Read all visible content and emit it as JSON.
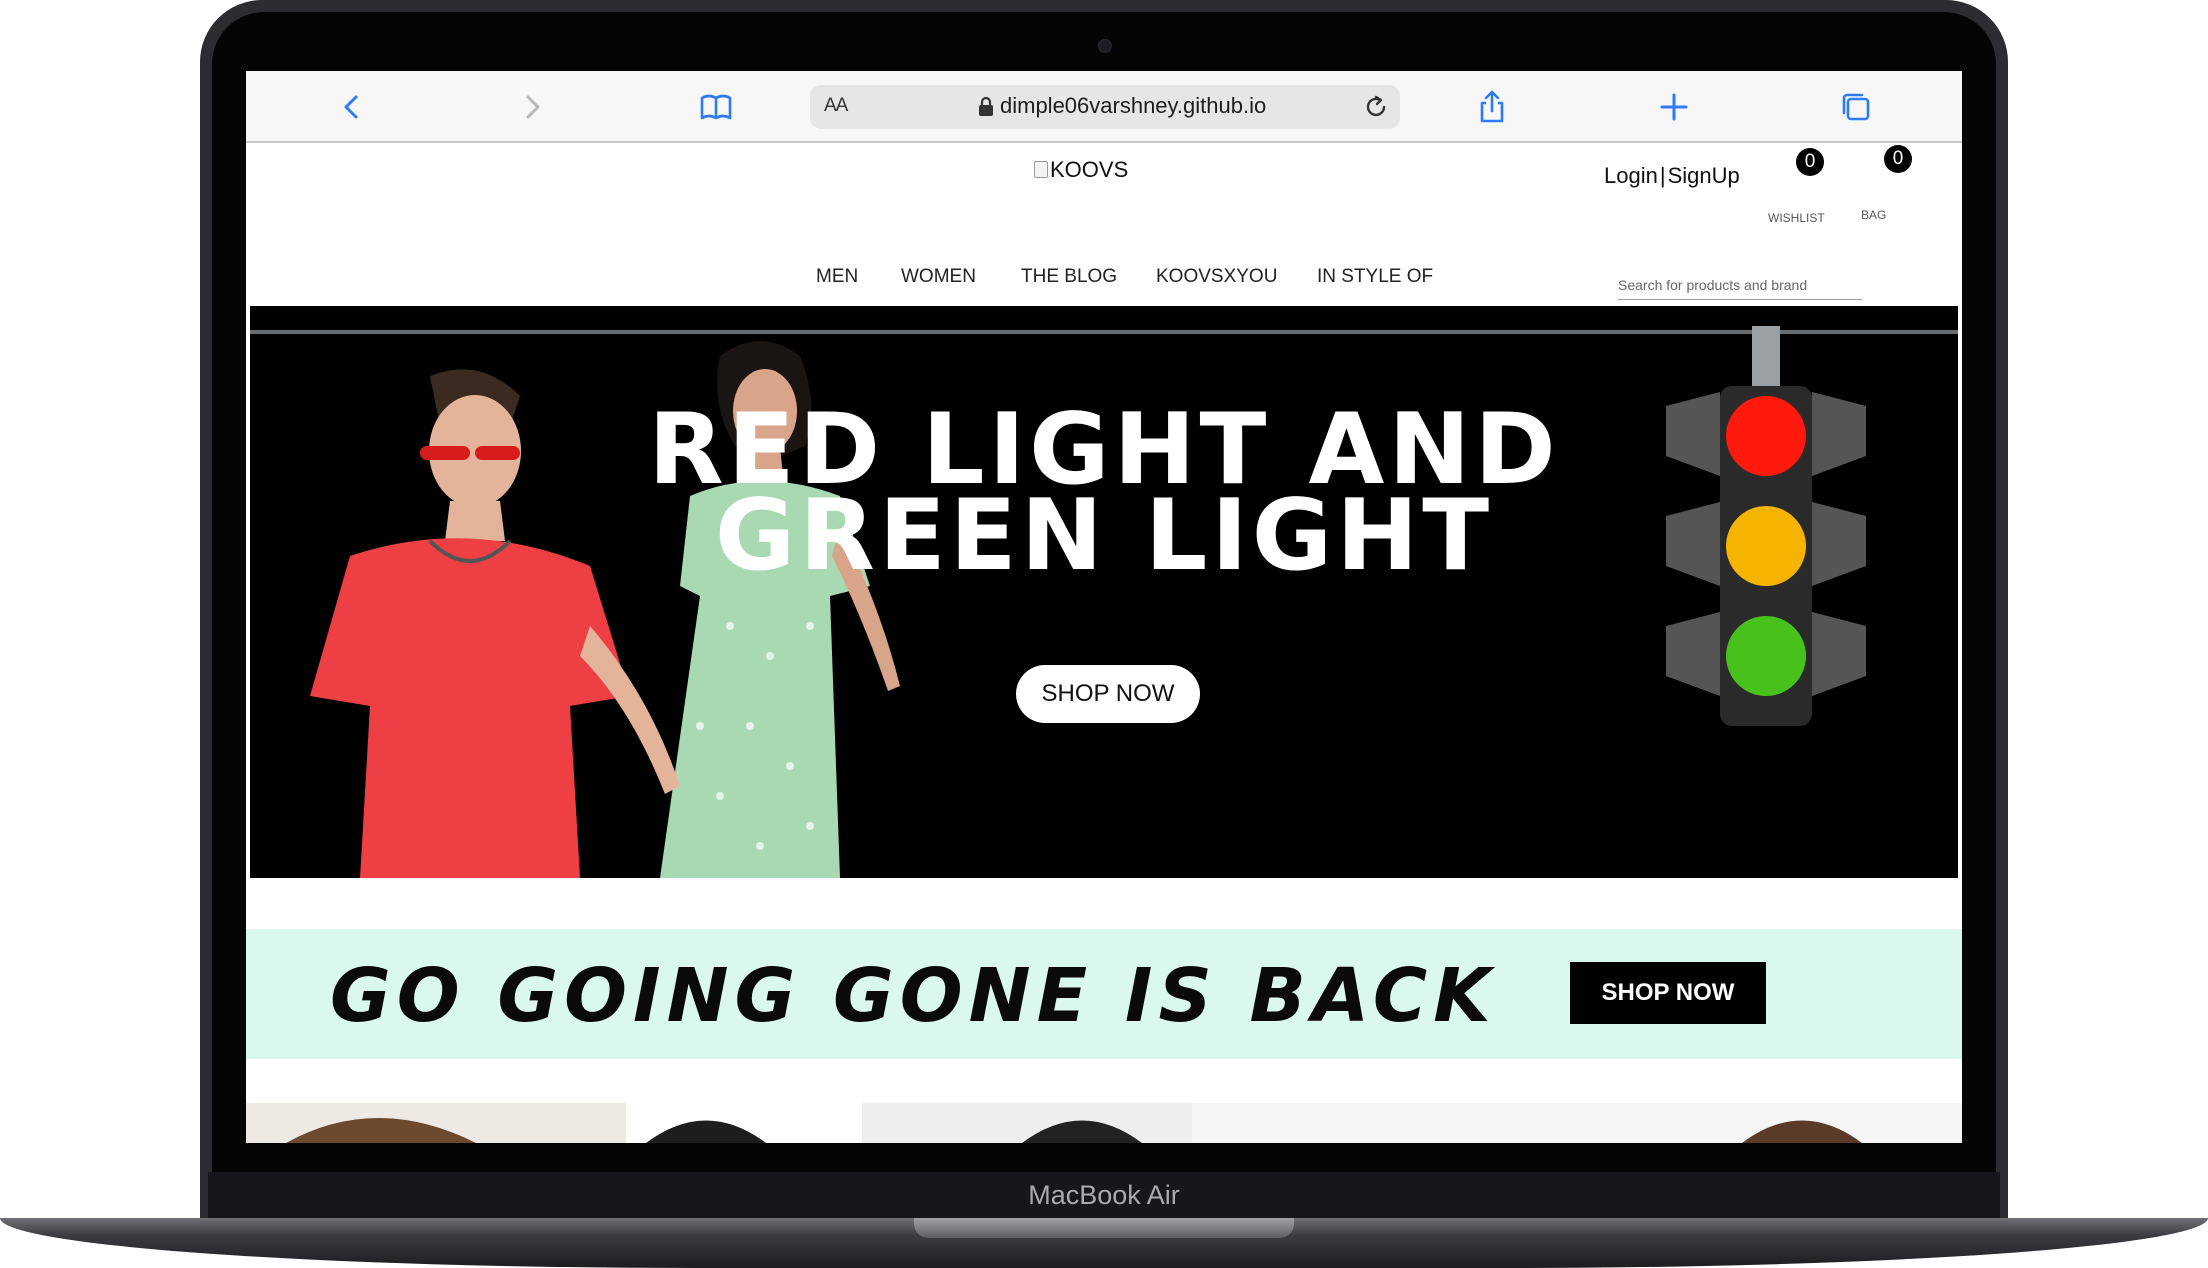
{
  "device": {
    "model_label": "MacBook Air"
  },
  "browser": {
    "text_size_label": "AA",
    "url": "dimple06varshney.github.io",
    "accent": "#2f7bf6"
  },
  "site": {
    "logo_alt": "KOOVS",
    "login_label": "Login",
    "signup_label": "SignUp",
    "wishlist": {
      "count": "0",
      "label": "WISHLIST"
    },
    "bag": {
      "count": "0",
      "label": "BAG"
    },
    "nav": [
      {
        "label": "MEN"
      },
      {
        "label": "WOMEN"
      },
      {
        "label": "THE BLOG"
      },
      {
        "label": "KOOVSXYOU"
      },
      {
        "label": "IN STYLE OF"
      }
    ],
    "search_placeholder": "Search for products and brand"
  },
  "hero": {
    "title_line1": "RED LIGHT AND",
    "title_line2": "GREEN LIGHT",
    "cta": "SHOP NOW",
    "colors": {
      "red_shirt": "#ee3f45",
      "dress": "#a8d9b3",
      "signal_red": "#ff1a0d",
      "signal_amber": "#f5b400",
      "signal_green": "#48c21a"
    }
  },
  "promo": {
    "title": "GO GOING GONE IS BACK",
    "cta": "SHOP NOW",
    "background": "#dbf8ef"
  }
}
